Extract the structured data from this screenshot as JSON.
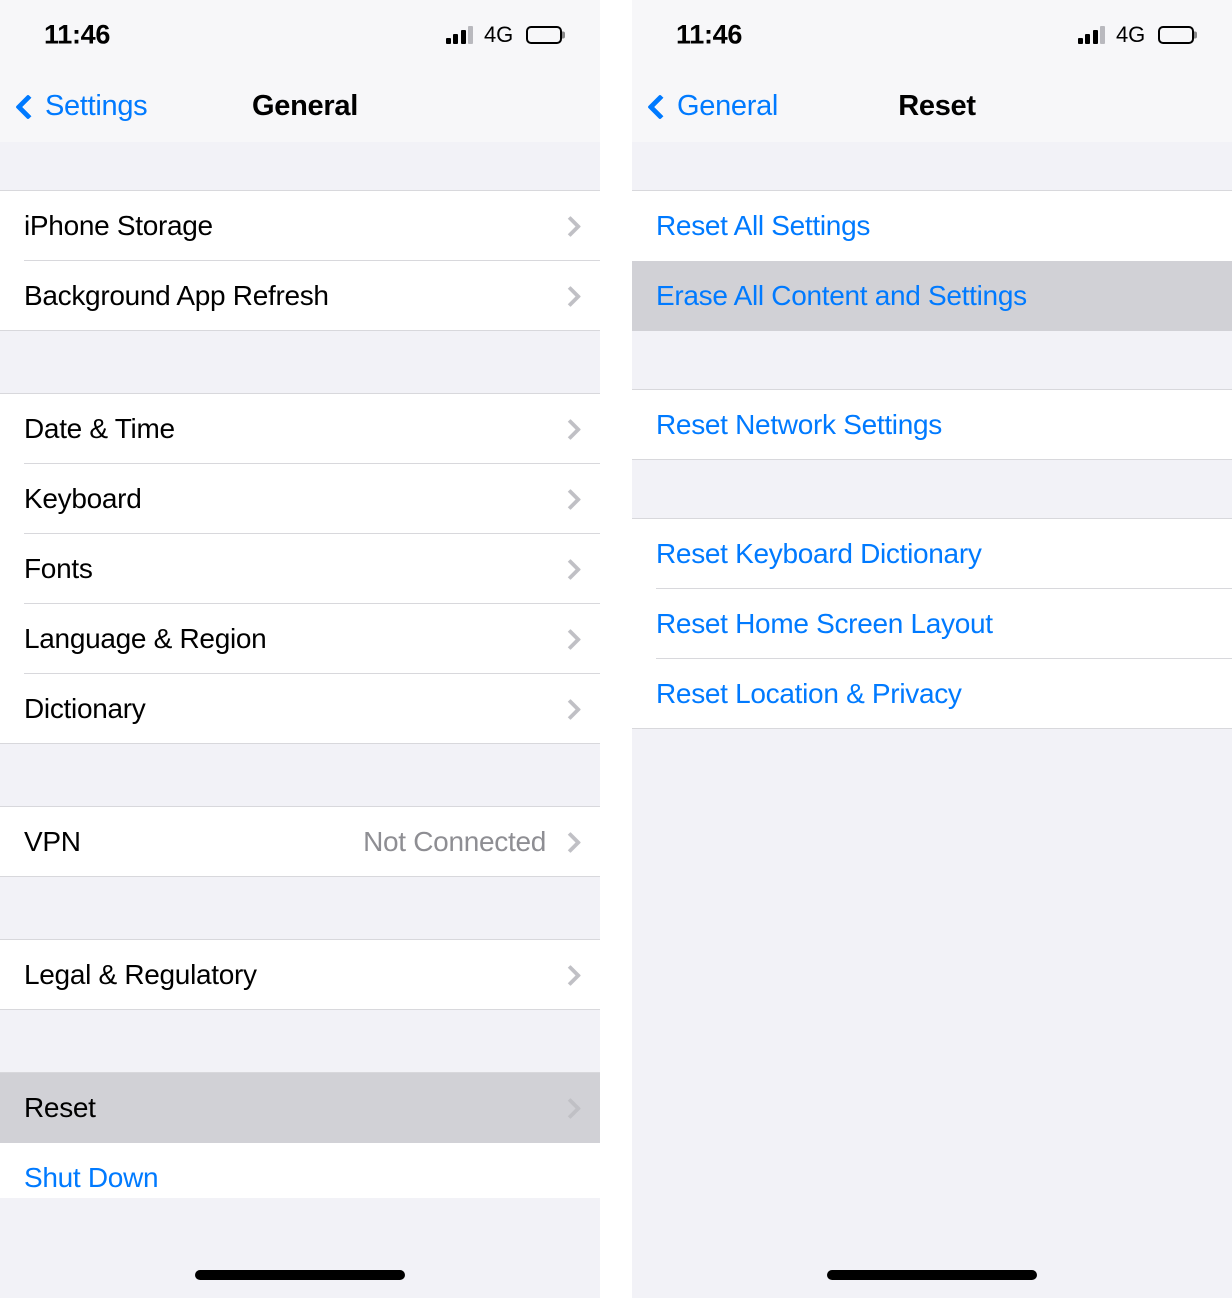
{
  "accent_blue": "#007AFF",
  "highlight_gray": "#D1D1D6",
  "background_gray": "#F2F2F7",
  "value_gray": "#8E8E93",
  "screens": [
    {
      "id": "general",
      "status": {
        "time": "11:46",
        "network": "4G",
        "signal_icon": "cellular-bars-icon",
        "battery_icon": "battery-icon"
      },
      "nav": {
        "back_label": "Settings",
        "back_icon": "chevron-left-icon",
        "title": "General"
      },
      "groups": [
        {
          "rows": [
            {
              "label": "iPhone Storage",
              "value": "",
              "chevron": true,
              "style": "default",
              "highlight": false
            },
            {
              "label": "Background App Refresh",
              "value": "",
              "chevron": true,
              "style": "default",
              "highlight": false
            }
          ]
        },
        {
          "rows": [
            {
              "label": "Date & Time",
              "value": "",
              "chevron": true,
              "style": "default",
              "highlight": false
            },
            {
              "label": "Keyboard",
              "value": "",
              "chevron": true,
              "style": "default",
              "highlight": false
            },
            {
              "label": "Fonts",
              "value": "",
              "chevron": true,
              "style": "default",
              "highlight": false
            },
            {
              "label": "Language & Region",
              "value": "",
              "chevron": true,
              "style": "default",
              "highlight": false
            },
            {
              "label": "Dictionary",
              "value": "",
              "chevron": true,
              "style": "default",
              "highlight": false
            }
          ]
        },
        {
          "rows": [
            {
              "label": "VPN",
              "value": "Not Connected",
              "chevron": true,
              "style": "default",
              "highlight": false
            }
          ]
        },
        {
          "rows": [
            {
              "label": "Legal & Regulatory",
              "value": "",
              "chevron": true,
              "style": "default",
              "highlight": false
            }
          ]
        },
        {
          "rows": [
            {
              "label": "Reset",
              "value": "",
              "chevron": true,
              "style": "default",
              "highlight": true
            },
            {
              "label": "Shut Down",
              "value": "",
              "chevron": false,
              "style": "blue",
              "highlight": false
            }
          ]
        }
      ]
    },
    {
      "id": "reset",
      "status": {
        "time": "11:46",
        "network": "4G",
        "signal_icon": "cellular-bars-icon",
        "battery_icon": "battery-icon"
      },
      "nav": {
        "back_label": "General",
        "back_icon": "chevron-left-icon",
        "title": "Reset"
      },
      "groups": [
        {
          "rows": [
            {
              "label": "Reset All Settings",
              "value": "",
              "chevron": false,
              "style": "blue",
              "highlight": false
            },
            {
              "label": "Erase All Content and Settings",
              "value": "",
              "chevron": false,
              "style": "blue",
              "highlight": true
            }
          ]
        },
        {
          "rows": [
            {
              "label": "Reset Network Settings",
              "value": "",
              "chevron": false,
              "style": "blue",
              "highlight": false
            }
          ]
        },
        {
          "rows": [
            {
              "label": "Reset Keyboard Dictionary",
              "value": "",
              "chevron": false,
              "style": "blue",
              "highlight": false
            },
            {
              "label": "Reset Home Screen Layout",
              "value": "",
              "chevron": false,
              "style": "blue",
              "highlight": false
            },
            {
              "label": "Reset Location & Privacy",
              "value": "",
              "chevron": false,
              "style": "blue",
              "highlight": false
            }
          ]
        }
      ]
    }
  ]
}
